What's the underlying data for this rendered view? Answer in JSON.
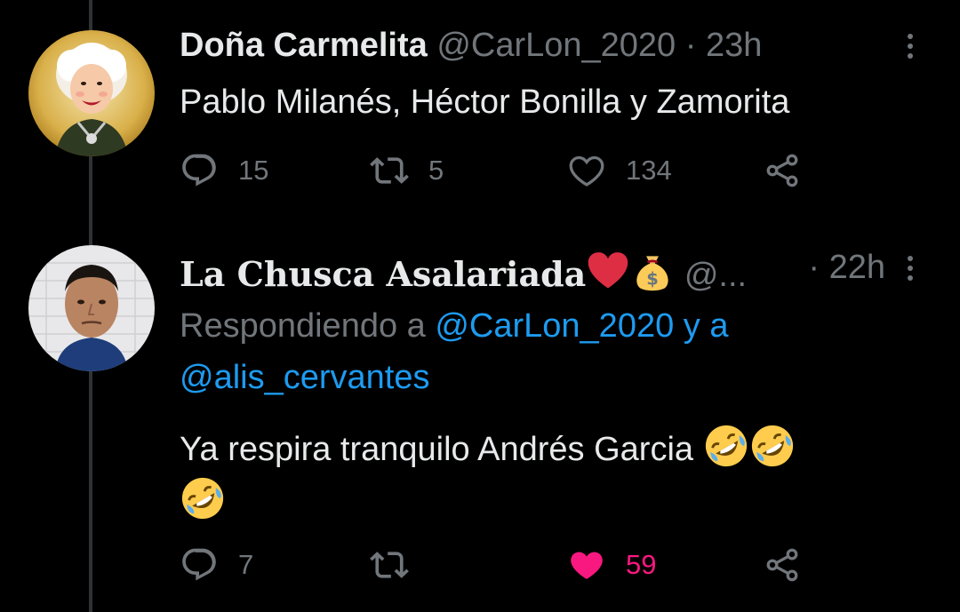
{
  "tweets": [
    {
      "display_name": "Doña Carmelita",
      "handle": "@CarLon_2020",
      "separator": "·",
      "time": "23h",
      "text": "Pablo Milanés, Héctor Bonilla y Zamorita",
      "actions": {
        "replies": "15",
        "retweets": "5",
        "likes": "134"
      },
      "liked": false
    },
    {
      "display_name": "La Chusca Asalariada",
      "display_name_emojis": [
        "red-heart-emoji",
        "money-bag-emoji"
      ],
      "handle": "@...",
      "separator": "·",
      "time": "22h",
      "replying_prefix": "Respondiendo a ",
      "replying_to": [
        "@CarLon_2020",
        "@alis_cervantes"
      ],
      "replying_joiner": " y a",
      "text": "Ya respira tranquilo Andrés Garcia",
      "text_emojis": [
        "rolling-on-floor-laughing-emoji",
        "rolling-on-floor-laughing-emoji",
        "rolling-on-floor-laughing-emoji"
      ],
      "actions": {
        "replies": "7",
        "retweets": "",
        "likes": "59"
      },
      "liked": true
    }
  ],
  "colors": {
    "background": "#000000",
    "text": "#e7e9ea",
    "muted": "#71767b",
    "link": "#1d9bf0",
    "like_active": "#f91880",
    "thread_line": "#2f3336"
  }
}
